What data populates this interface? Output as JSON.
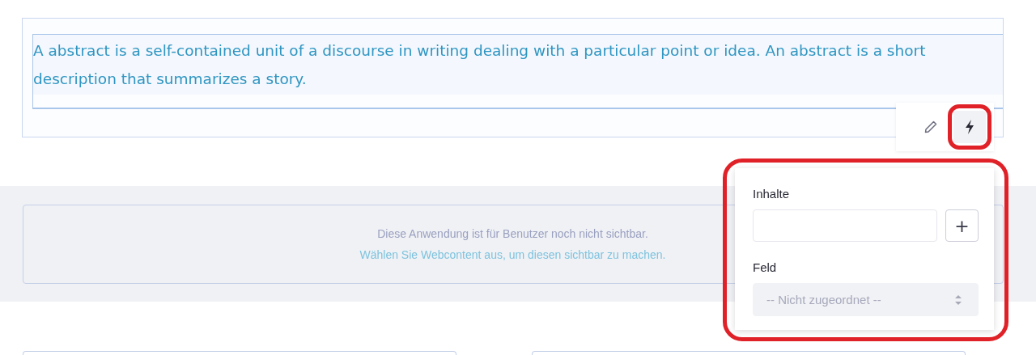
{
  "abstract": {
    "text": "A abstract is a self-contained unit of a discourse in writing dealing with a particular point or idea. An abstract is a short description that summarizes a story."
  },
  "toolbar": [
    {
      "kind": "edit",
      "selected": false
    },
    {
      "kind": "map",
      "selected": true
    }
  ],
  "notice": {
    "line_1": "Diese Anwendung ist für Benutzer noch nicht sichtbar.",
    "line_2": "Wählen Sie Webcontent aus, um diesen sichtbar zu machen."
  },
  "mapping_panel": {
    "content_label": "Inhalte",
    "add_button": "+",
    "field_label": "Feld",
    "field_select": {
      "value": "-- Nicht zugeordnet --",
      "disabled": true
    }
  }
}
